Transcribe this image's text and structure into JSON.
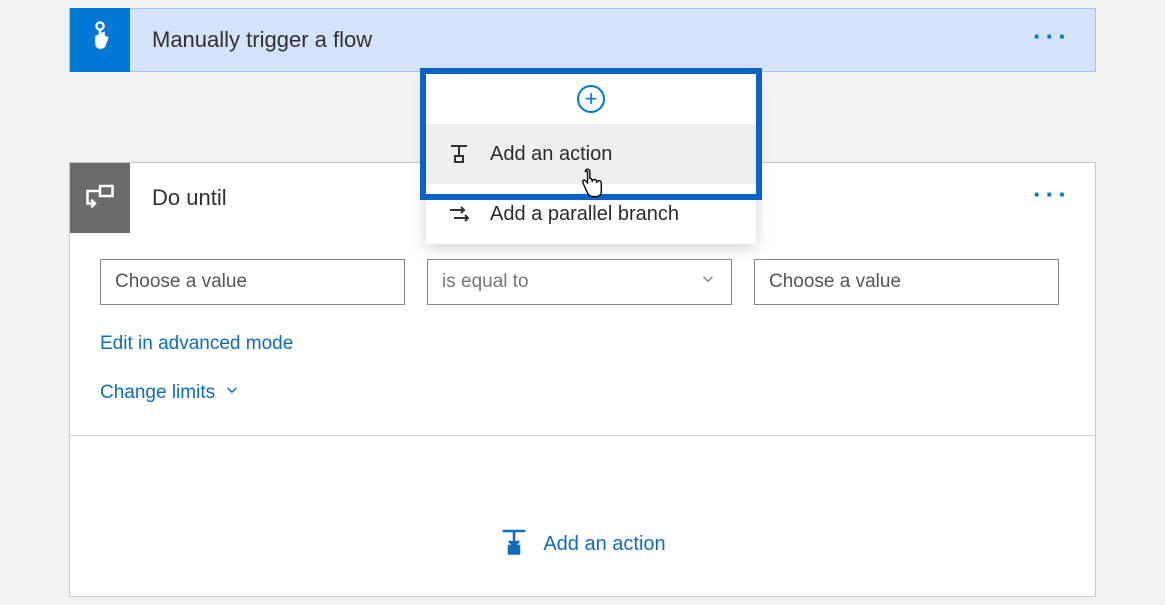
{
  "trigger": {
    "title": "Manually trigger a flow"
  },
  "popup": {
    "add_action": "Add an action",
    "add_parallel": "Add a parallel branch"
  },
  "do_until": {
    "title": "Do until",
    "left_placeholder": "Choose a value",
    "operator": "is equal to",
    "right_placeholder": "Choose a value",
    "advanced_link": "Edit in advanced mode",
    "change_limits": "Change limits",
    "footer_add_action": "Add an action"
  }
}
